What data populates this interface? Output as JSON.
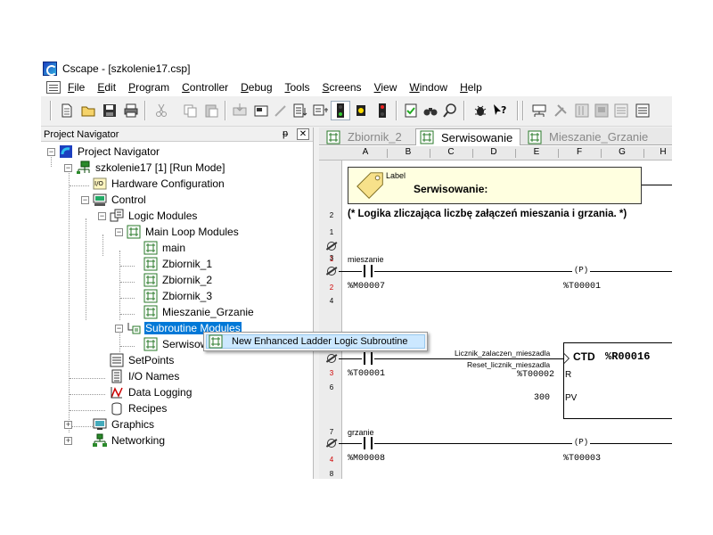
{
  "window": {
    "title": "Cscape - [szkolenie17.csp]"
  },
  "menu": [
    "File",
    "Edit",
    "Program",
    "Controller",
    "Debug",
    "Tools",
    "Screens",
    "View",
    "Window",
    "Help"
  ],
  "navigator": {
    "header": "Project Navigator",
    "pin_glyph": "ᵽ",
    "close_glyph": "✕",
    "tree": [
      {
        "label": "Project Navigator",
        "icon": "project-navigator-icon"
      },
      {
        "label": "szkolenie17 [1] [Run Mode]",
        "icon": "network-controller-icon"
      },
      {
        "label": "Hardware Configuration",
        "icon": "io-config-icon"
      },
      {
        "label": "Control",
        "icon": "control-icon"
      },
      {
        "label": "Logic Modules",
        "icon": "logic-modules-icon"
      },
      {
        "label": "Main Loop Modules",
        "icon": "ladder-module-icon"
      },
      {
        "label": "main",
        "icon": "ladder-module-icon"
      },
      {
        "label": "Zbiornik_1",
        "icon": "ladder-module-icon"
      },
      {
        "label": "Zbiornik_2",
        "icon": "ladder-module-icon"
      },
      {
        "label": "Zbiornik_3",
        "icon": "ladder-module-icon"
      },
      {
        "label": "Mieszanie_Grzanie",
        "icon": "ladder-module-icon"
      },
      {
        "label": "Subroutine Modules",
        "icon": "subroutine-icon"
      },
      {
        "label": "Serwisow",
        "icon": "ladder-module-icon"
      },
      {
        "label": "SetPoints",
        "icon": "setpoints-icon"
      },
      {
        "label": "I/O Names",
        "icon": "io-names-icon"
      },
      {
        "label": "Data Logging",
        "icon": "data-logging-icon"
      },
      {
        "label": "Recipes",
        "icon": "recipes-icon"
      },
      {
        "label": "Graphics",
        "icon": "graphics-icon"
      },
      {
        "label": "Networking",
        "icon": "networking-icon"
      }
    ]
  },
  "context_menu": {
    "item": "New Enhanced Ladder Logic Subroutine"
  },
  "tabs": [
    {
      "label": "Zbiornik_2",
      "active": false
    },
    {
      "label": "Serwisowanie",
      "active": true
    },
    {
      "label": "Mieszanie_Grzanie",
      "active": false
    }
  ],
  "columns": [
    "A",
    "B",
    "C",
    "D",
    "E",
    "F",
    "G",
    "H"
  ],
  "ladder": {
    "rung1": {
      "num": "1",
      "red_num": "1",
      "label_tag": "Label",
      "label_text": "Serwisowanie:"
    },
    "rung2": {
      "num": "2",
      "comment": "(* Logika zliczająca liczbę załączeń mieszania i grzania. *)"
    },
    "rung3": {
      "num": "3",
      "red_num": "2",
      "num2": "4",
      "contact_name": "mieszanie",
      "contact_addr": "%M00007",
      "coil_sym": "(P)",
      "coil_addr": "%T00001"
    },
    "rung5": {
      "num": "5",
      "red_num": "3",
      "num2": "6",
      "contact_addr": "%T00001",
      "in1": "Licznik_zalaczen_mieszadla",
      "in2": "Reset_licznik_mieszadla",
      "reset_addr": "%T00002",
      "r_pin": "R",
      "pv_value": "300",
      "pv_pin": "PV",
      "block_name": "CTD",
      "block_addr": "%R00016"
    },
    "rung7": {
      "num": "7",
      "red_num": "4",
      "num2": "8",
      "contact_name": "grzanie",
      "contact_addr": "%M00008",
      "coil_sym": "(P)",
      "coil_addr": "%T00003"
    }
  }
}
